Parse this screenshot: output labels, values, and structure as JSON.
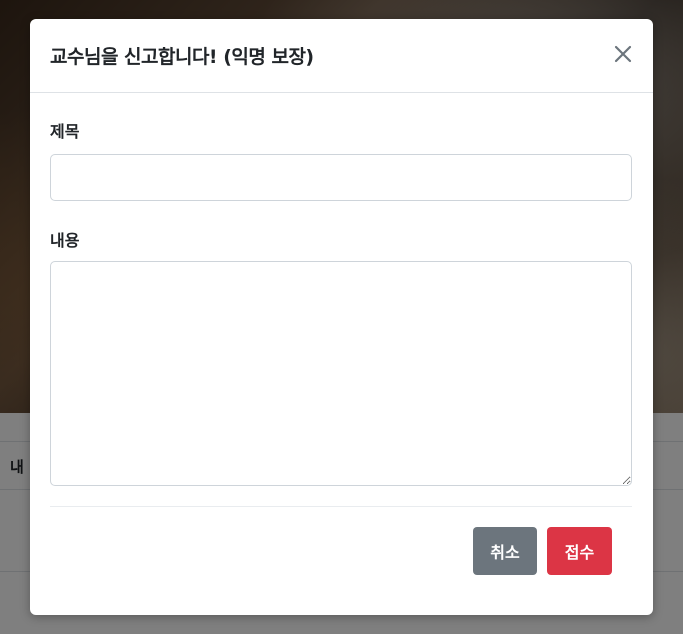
{
  "modal": {
    "title": "교수님을 신고합니다! (익명 보장)",
    "close_icon": "close-icon",
    "subject_label": "제목",
    "subject_value": "",
    "content_label": "내용",
    "content_value": "",
    "cancel_label": "취소",
    "submit_label": "접수"
  },
  "background": {
    "table_header_partial": "내"
  },
  "colors": {
    "cancel": "#6c757d",
    "submit": "#dc3545",
    "backdrop": "rgba(0,0,0,0.5)"
  }
}
